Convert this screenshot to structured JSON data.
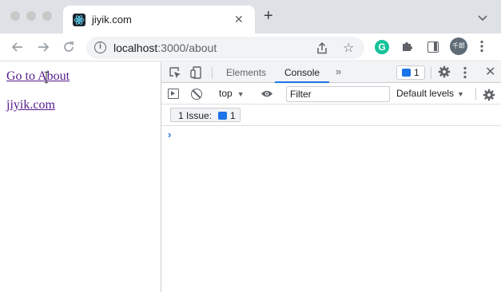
{
  "tab": {
    "title": "jiyik.com",
    "close_glyph": "✕",
    "new_tab_glyph": "+"
  },
  "address_bar": {
    "host": "localhost",
    "path": ":3000/about",
    "info_glyph": "i"
  },
  "extensions": {
    "grammarly_letter": "G",
    "avatar_text": "千郎"
  },
  "page": {
    "links": [
      {
        "label": "Go to About"
      },
      {
        "label": "jiyik.com"
      }
    ]
  },
  "devtools": {
    "tabs": [
      {
        "label": "Elements",
        "active": false
      },
      {
        "label": "Console",
        "active": true
      }
    ],
    "more_tabs_glyph": "»",
    "issues_badge_count": "1",
    "close_glyph": "✕",
    "console_toolbar": {
      "context": "top",
      "filter_placeholder": "Filter",
      "levels": "Default levels"
    },
    "issues_bar": {
      "label": "1 Issue:",
      "count": "1"
    },
    "prompt_glyph": "›"
  },
  "icons": [
    "react-favicon-icon",
    "back-arrow-icon",
    "forward-arrow-icon",
    "reload-icon",
    "info-icon",
    "share-icon",
    "star-icon",
    "puzzle-icon",
    "side-panel-icon",
    "kebab-menu-icon",
    "inspect-element-icon",
    "device-toolbar-icon",
    "settings-gear-icon",
    "sidebar-toggle-icon",
    "clear-console-icon",
    "eye-icon",
    "chevron-down-icon"
  ],
  "colors": {
    "tab_strip": "#dee1e6",
    "link_visited": "#551a8b",
    "accent_blue": "#1a73e8",
    "grammarly_green": "#15c39a"
  }
}
